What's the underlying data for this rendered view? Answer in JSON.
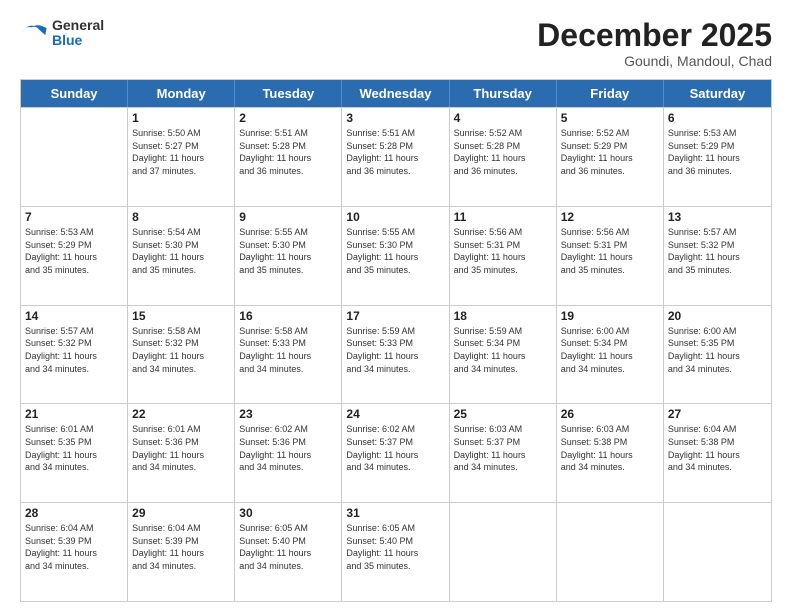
{
  "logo": {
    "general": "General",
    "blue": "Blue"
  },
  "title": "December 2025",
  "location": "Goundi, Mandoul, Chad",
  "days": [
    "Sunday",
    "Monday",
    "Tuesday",
    "Wednesday",
    "Thursday",
    "Friday",
    "Saturday"
  ],
  "weeks": [
    [
      {
        "day": "",
        "info": ""
      },
      {
        "day": "1",
        "info": "Sunrise: 5:50 AM\nSunset: 5:27 PM\nDaylight: 11 hours\nand 37 minutes."
      },
      {
        "day": "2",
        "info": "Sunrise: 5:51 AM\nSunset: 5:28 PM\nDaylight: 11 hours\nand 36 minutes."
      },
      {
        "day": "3",
        "info": "Sunrise: 5:51 AM\nSunset: 5:28 PM\nDaylight: 11 hours\nand 36 minutes."
      },
      {
        "day": "4",
        "info": "Sunrise: 5:52 AM\nSunset: 5:28 PM\nDaylight: 11 hours\nand 36 minutes."
      },
      {
        "day": "5",
        "info": "Sunrise: 5:52 AM\nSunset: 5:29 PM\nDaylight: 11 hours\nand 36 minutes."
      },
      {
        "day": "6",
        "info": "Sunrise: 5:53 AM\nSunset: 5:29 PM\nDaylight: 11 hours\nand 36 minutes."
      }
    ],
    [
      {
        "day": "7",
        "info": "Sunrise: 5:53 AM\nSunset: 5:29 PM\nDaylight: 11 hours\nand 35 minutes."
      },
      {
        "day": "8",
        "info": "Sunrise: 5:54 AM\nSunset: 5:30 PM\nDaylight: 11 hours\nand 35 minutes."
      },
      {
        "day": "9",
        "info": "Sunrise: 5:55 AM\nSunset: 5:30 PM\nDaylight: 11 hours\nand 35 minutes."
      },
      {
        "day": "10",
        "info": "Sunrise: 5:55 AM\nSunset: 5:30 PM\nDaylight: 11 hours\nand 35 minutes."
      },
      {
        "day": "11",
        "info": "Sunrise: 5:56 AM\nSunset: 5:31 PM\nDaylight: 11 hours\nand 35 minutes."
      },
      {
        "day": "12",
        "info": "Sunrise: 5:56 AM\nSunset: 5:31 PM\nDaylight: 11 hours\nand 35 minutes."
      },
      {
        "day": "13",
        "info": "Sunrise: 5:57 AM\nSunset: 5:32 PM\nDaylight: 11 hours\nand 35 minutes."
      }
    ],
    [
      {
        "day": "14",
        "info": "Sunrise: 5:57 AM\nSunset: 5:32 PM\nDaylight: 11 hours\nand 34 minutes."
      },
      {
        "day": "15",
        "info": "Sunrise: 5:58 AM\nSunset: 5:32 PM\nDaylight: 11 hours\nand 34 minutes."
      },
      {
        "day": "16",
        "info": "Sunrise: 5:58 AM\nSunset: 5:33 PM\nDaylight: 11 hours\nand 34 minutes."
      },
      {
        "day": "17",
        "info": "Sunrise: 5:59 AM\nSunset: 5:33 PM\nDaylight: 11 hours\nand 34 minutes."
      },
      {
        "day": "18",
        "info": "Sunrise: 5:59 AM\nSunset: 5:34 PM\nDaylight: 11 hours\nand 34 minutes."
      },
      {
        "day": "19",
        "info": "Sunrise: 6:00 AM\nSunset: 5:34 PM\nDaylight: 11 hours\nand 34 minutes."
      },
      {
        "day": "20",
        "info": "Sunrise: 6:00 AM\nSunset: 5:35 PM\nDaylight: 11 hours\nand 34 minutes."
      }
    ],
    [
      {
        "day": "21",
        "info": "Sunrise: 6:01 AM\nSunset: 5:35 PM\nDaylight: 11 hours\nand 34 minutes."
      },
      {
        "day": "22",
        "info": "Sunrise: 6:01 AM\nSunset: 5:36 PM\nDaylight: 11 hours\nand 34 minutes."
      },
      {
        "day": "23",
        "info": "Sunrise: 6:02 AM\nSunset: 5:36 PM\nDaylight: 11 hours\nand 34 minutes."
      },
      {
        "day": "24",
        "info": "Sunrise: 6:02 AM\nSunset: 5:37 PM\nDaylight: 11 hours\nand 34 minutes."
      },
      {
        "day": "25",
        "info": "Sunrise: 6:03 AM\nSunset: 5:37 PM\nDaylight: 11 hours\nand 34 minutes."
      },
      {
        "day": "26",
        "info": "Sunrise: 6:03 AM\nSunset: 5:38 PM\nDaylight: 11 hours\nand 34 minutes."
      },
      {
        "day": "27",
        "info": "Sunrise: 6:04 AM\nSunset: 5:38 PM\nDaylight: 11 hours\nand 34 minutes."
      }
    ],
    [
      {
        "day": "28",
        "info": "Sunrise: 6:04 AM\nSunset: 5:39 PM\nDaylight: 11 hours\nand 34 minutes."
      },
      {
        "day": "29",
        "info": "Sunrise: 6:04 AM\nSunset: 5:39 PM\nDaylight: 11 hours\nand 34 minutes."
      },
      {
        "day": "30",
        "info": "Sunrise: 6:05 AM\nSunset: 5:40 PM\nDaylight: 11 hours\nand 34 minutes."
      },
      {
        "day": "31",
        "info": "Sunrise: 6:05 AM\nSunset: 5:40 PM\nDaylight: 11 hours\nand 35 minutes."
      },
      {
        "day": "",
        "info": ""
      },
      {
        "day": "",
        "info": ""
      },
      {
        "day": "",
        "info": ""
      }
    ]
  ]
}
